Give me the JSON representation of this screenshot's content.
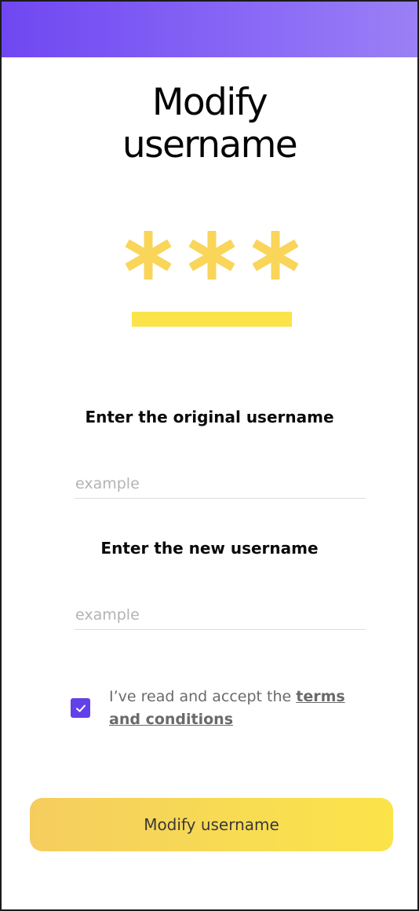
{
  "header": {
    "gradient_start": "#7047f2",
    "gradient_end": "#9a80f5"
  },
  "page": {
    "title_line1": "Modify",
    "title_line2": "username"
  },
  "hero": {
    "icon": "masked-password-icon",
    "color": "#f9d55a"
  },
  "form": {
    "original_label": "Enter the original username",
    "original_placeholder": "example",
    "original_value": "",
    "new_label": "Enter the new username",
    "new_placeholder": "example",
    "new_value": ""
  },
  "terms": {
    "checked": true,
    "checkbox_color": "#6241e9",
    "prefix": "I’ve read and accept the ",
    "link": "terms and conditions"
  },
  "cta": {
    "label": "Modify username",
    "color": "#f8dc52"
  }
}
